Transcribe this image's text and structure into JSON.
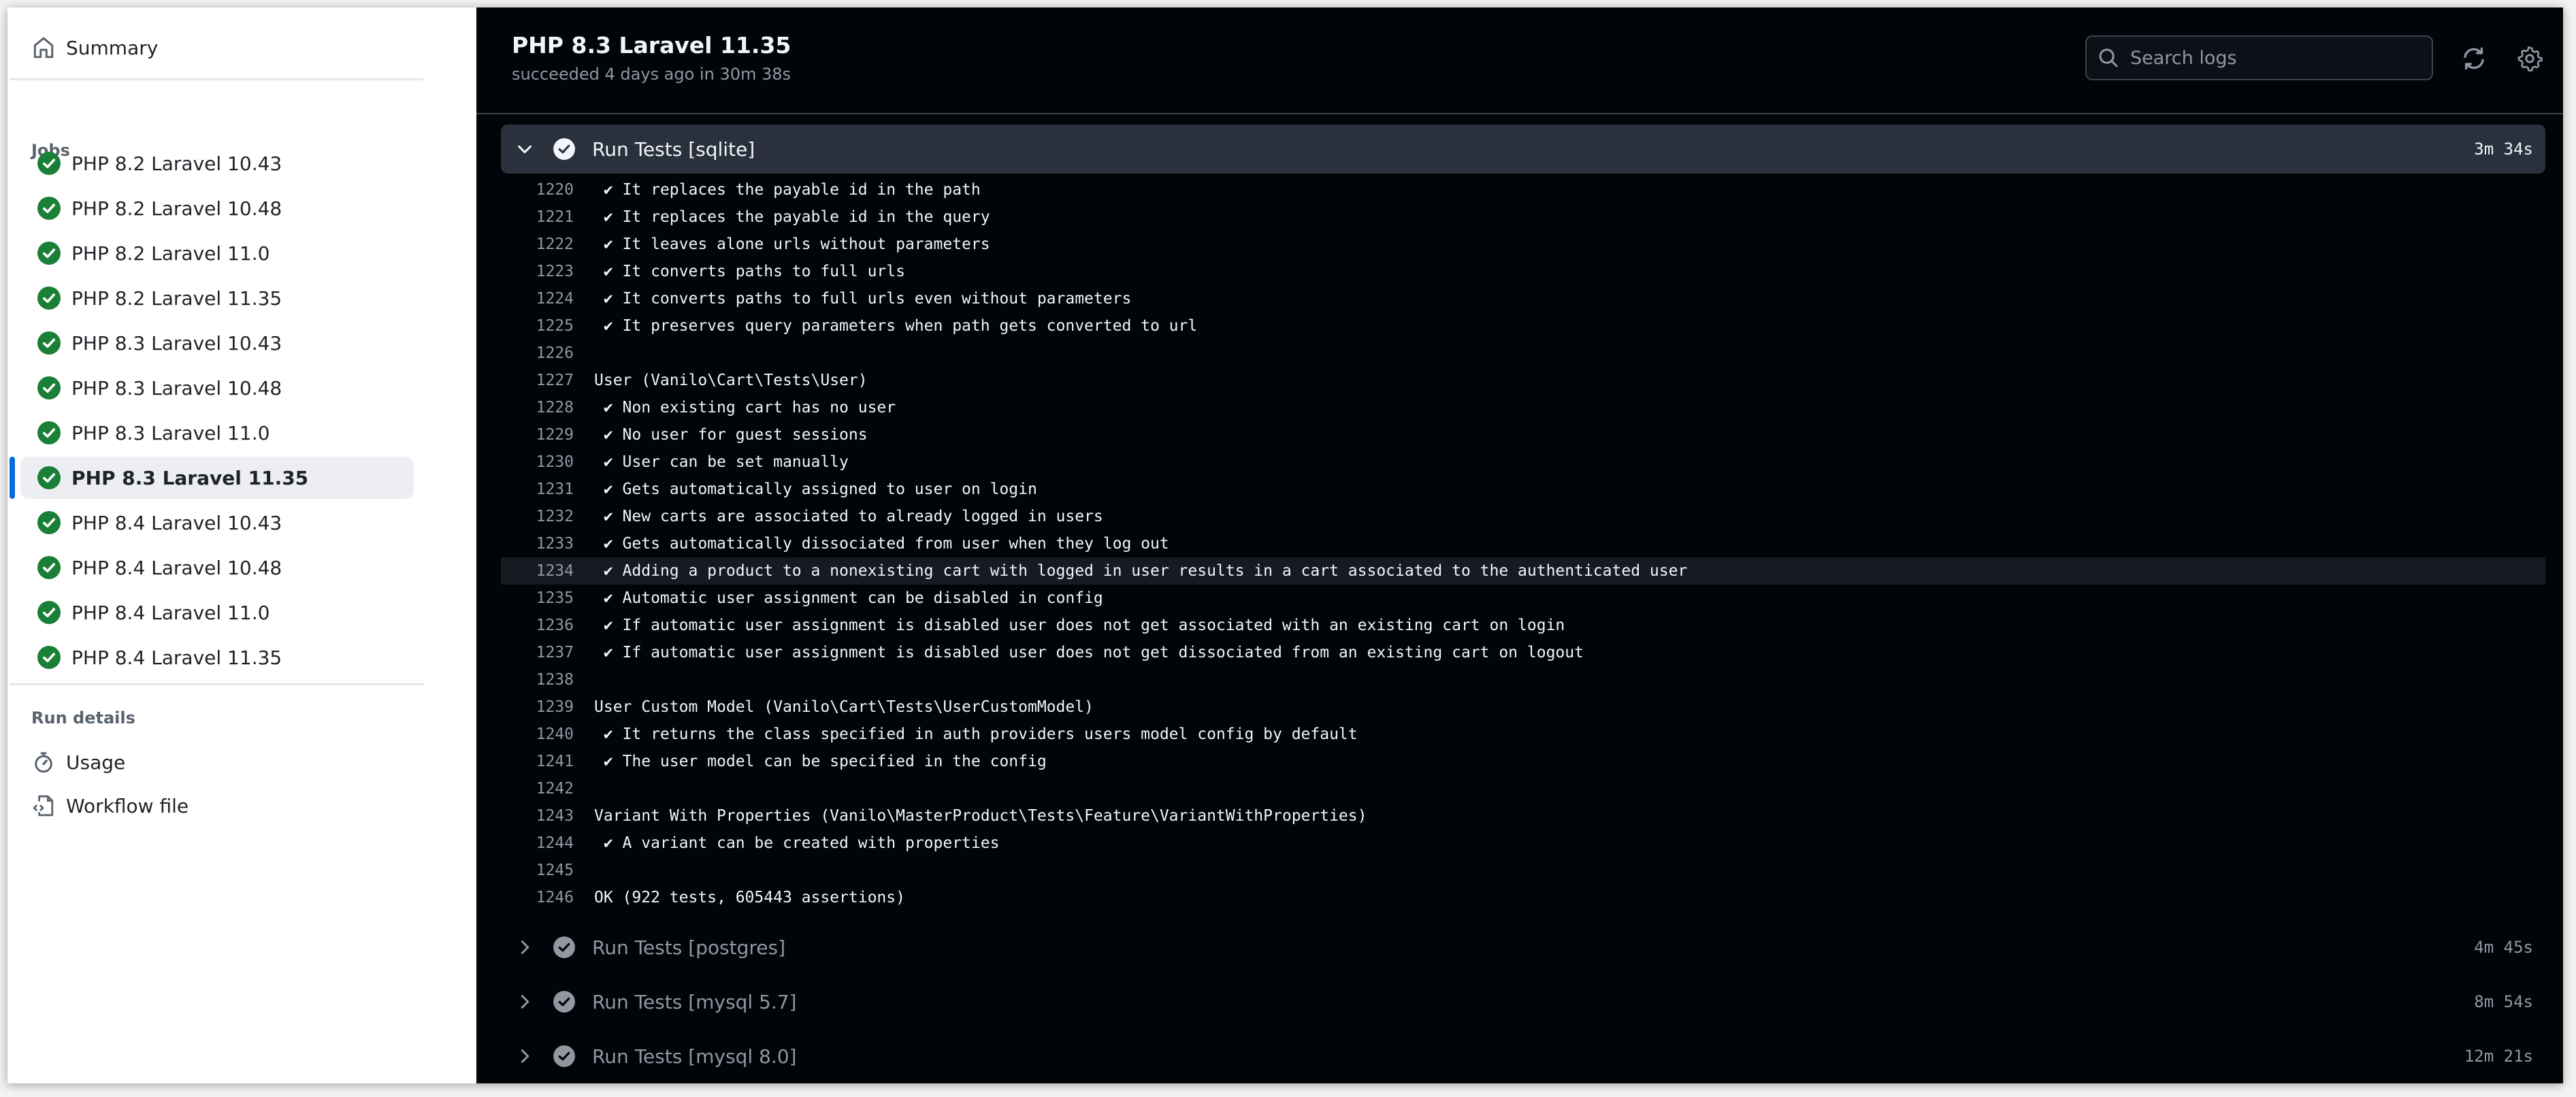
{
  "sidebar": {
    "summary_label": "Summary",
    "jobs_heading": "Jobs",
    "jobs": [
      {
        "label": "PHP 8.2 Laravel 10.43",
        "status": "success",
        "selected": false
      },
      {
        "label": "PHP 8.2 Laravel 10.48",
        "status": "success",
        "selected": false
      },
      {
        "label": "PHP 8.2 Laravel 11.0",
        "status": "success",
        "selected": false
      },
      {
        "label": "PHP 8.2 Laravel 11.35",
        "status": "success",
        "selected": false
      },
      {
        "label": "PHP 8.3 Laravel 10.43",
        "status": "success",
        "selected": false
      },
      {
        "label": "PHP 8.3 Laravel 10.48",
        "status": "success",
        "selected": false
      },
      {
        "label": "PHP 8.3 Laravel 11.0",
        "status": "success",
        "selected": false
      },
      {
        "label": "PHP 8.3 Laravel 11.35",
        "status": "success",
        "selected": true
      },
      {
        "label": "PHP 8.4 Laravel 10.43",
        "status": "success",
        "selected": false
      },
      {
        "label": "PHP 8.4 Laravel 10.48",
        "status": "success",
        "selected": false
      },
      {
        "label": "PHP 8.4 Laravel 11.0",
        "status": "success",
        "selected": false
      },
      {
        "label": "PHP 8.4 Laravel 11.35",
        "status": "success",
        "selected": false
      }
    ],
    "run_details_heading": "Run details",
    "usage_label": "Usage",
    "workflow_file_label": "Workflow file"
  },
  "header": {
    "title": "PHP 8.3 Laravel 11.35",
    "subtitle": "succeeded 4 days ago in 30m 38s",
    "search_placeholder": "Search logs",
    "search_value": ""
  },
  "steps": [
    {
      "name": "Run Tests [sqlite]",
      "duration": "3m 34s",
      "expanded": true,
      "lines": [
        {
          "n": "1220",
          "text": " ✔ It replaces the payable id in the path"
        },
        {
          "n": "1221",
          "text": " ✔ It replaces the payable id in the query"
        },
        {
          "n": "1222",
          "text": " ✔ It leaves alone urls without parameters"
        },
        {
          "n": "1223",
          "text": " ✔ It converts paths to full urls"
        },
        {
          "n": "1224",
          "text": " ✔ It converts paths to full urls even without parameters"
        },
        {
          "n": "1225",
          "text": " ✔ It preserves query parameters when path gets converted to url"
        },
        {
          "n": "1226",
          "text": ""
        },
        {
          "n": "1227",
          "text": "User (Vanilo\\Cart\\Tests\\User)"
        },
        {
          "n": "1228",
          "text": " ✔ Non existing cart has no user"
        },
        {
          "n": "1229",
          "text": " ✔ No user for guest sessions"
        },
        {
          "n": "1230",
          "text": " ✔ User can be set manually"
        },
        {
          "n": "1231",
          "text": " ✔ Gets automatically assigned to user on login"
        },
        {
          "n": "1232",
          "text": " ✔ New carts are associated to already logged in users"
        },
        {
          "n": "1233",
          "text": " ✔ Gets automatically dissociated from user when they log out"
        },
        {
          "n": "1234",
          "text": " ✔ Adding a product to a nonexisting cart with logged in user results in a cart associated to the authenticated user",
          "highlighted": true
        },
        {
          "n": "1235",
          "text": " ✔ Automatic user assignment can be disabled in config"
        },
        {
          "n": "1236",
          "text": " ✔ If automatic user assignment is disabled user does not get associated with an existing cart on login"
        },
        {
          "n": "1237",
          "text": " ✔ If automatic user assignment is disabled user does not get dissociated from an existing cart on logout"
        },
        {
          "n": "1238",
          "text": ""
        },
        {
          "n": "1239",
          "text": "User Custom Model (Vanilo\\Cart\\Tests\\UserCustomModel)"
        },
        {
          "n": "1240",
          "text": " ✔ It returns the class specified in auth providers users model config by default"
        },
        {
          "n": "1241",
          "text": " ✔ The user model can be specified in the config"
        },
        {
          "n": "1242",
          "text": ""
        },
        {
          "n": "1243",
          "text": "Variant With Properties (Vanilo\\MasterProduct\\Tests\\Feature\\VariantWithProperties)"
        },
        {
          "n": "1244",
          "text": " ✔ A variant can be created with properties"
        },
        {
          "n": "1245",
          "text": ""
        },
        {
          "n": "1246",
          "text": "OK (922 tests, 605443 assertions)"
        }
      ]
    },
    {
      "name": "Run Tests [postgres]",
      "duration": "4m 45s",
      "expanded": false
    },
    {
      "name": "Run Tests [mysql 5.7]",
      "duration": "8m 54s",
      "expanded": false
    },
    {
      "name": "Run Tests [mysql 8.0]",
      "duration": "12m 21s",
      "expanded": false
    }
  ],
  "colors": {
    "success_green": "#1a7f37",
    "accent_blue": "#0969da",
    "log_bg": "#010409",
    "step_header_bg": "#2a313c",
    "highlight_row": "#161b22"
  }
}
